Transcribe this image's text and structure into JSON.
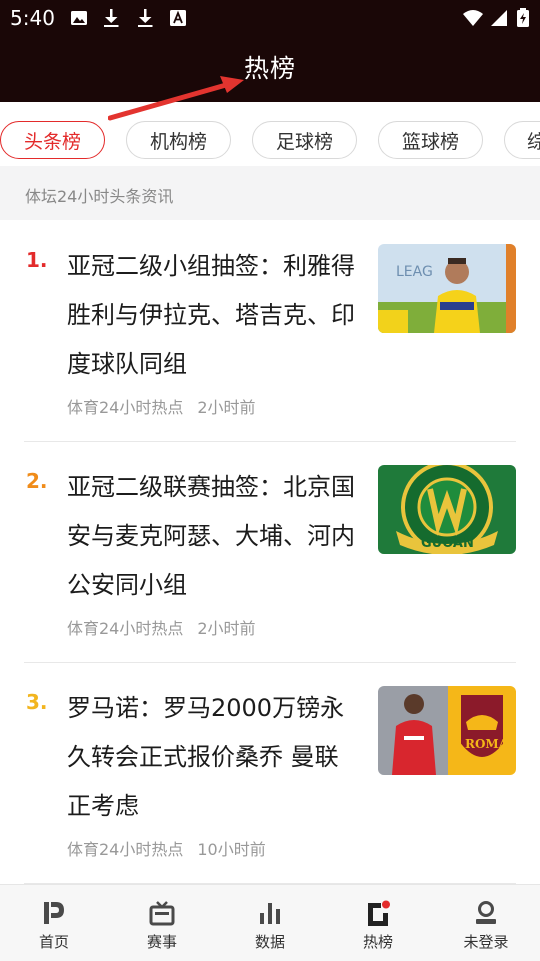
{
  "status_bar": {
    "time": "5:40"
  },
  "header": {
    "title": "热榜"
  },
  "tabs": [
    {
      "label": "头条榜",
      "active": true
    },
    {
      "label": "机构榜",
      "active": false
    },
    {
      "label": "足球榜",
      "active": false
    },
    {
      "label": "篮球榜",
      "active": false
    },
    {
      "label": "综",
      "active": false
    }
  ],
  "subheader": {
    "text": "体坛24小时头条资讯"
  },
  "news": [
    {
      "rank": "1.",
      "rank_color": "#e32b2b",
      "title": "亚冠二级小组抽签：利雅得胜利与伊拉克、塔吉克、印度球队同组",
      "source": "体育24小时热点",
      "time": "2小时前",
      "thumb_text": "LEAG"
    },
    {
      "rank": "2.",
      "rank_color": "#f08c1a",
      "title": "亚冠二级联赛抽签：北京国安与麦克阿瑟、大埔、河内公安同小组",
      "source": "体育24小时热点",
      "time": "2小时前",
      "thumb_text": "GUOAN"
    },
    {
      "rank": "3.",
      "rank_color": "#f2b51f",
      "title": "罗马诺：罗马2000万镑永久转会正式报价桑乔 曼联正考虑",
      "source": "体育24小时热点",
      "time": "10小时前",
      "thumb_text": "ROMA"
    }
  ],
  "bottom_nav": [
    {
      "label": "首页",
      "icon": "home-logo-icon"
    },
    {
      "label": "赛事",
      "icon": "tv-icon"
    },
    {
      "label": "数据",
      "icon": "bar-chart-icon"
    },
    {
      "label": "热榜",
      "icon": "hot-list-icon",
      "active": true
    },
    {
      "label": "未登录",
      "icon": "user-icon"
    }
  ],
  "colors": {
    "header_bg": "#1a0707",
    "accent": "#e32b2b"
  }
}
